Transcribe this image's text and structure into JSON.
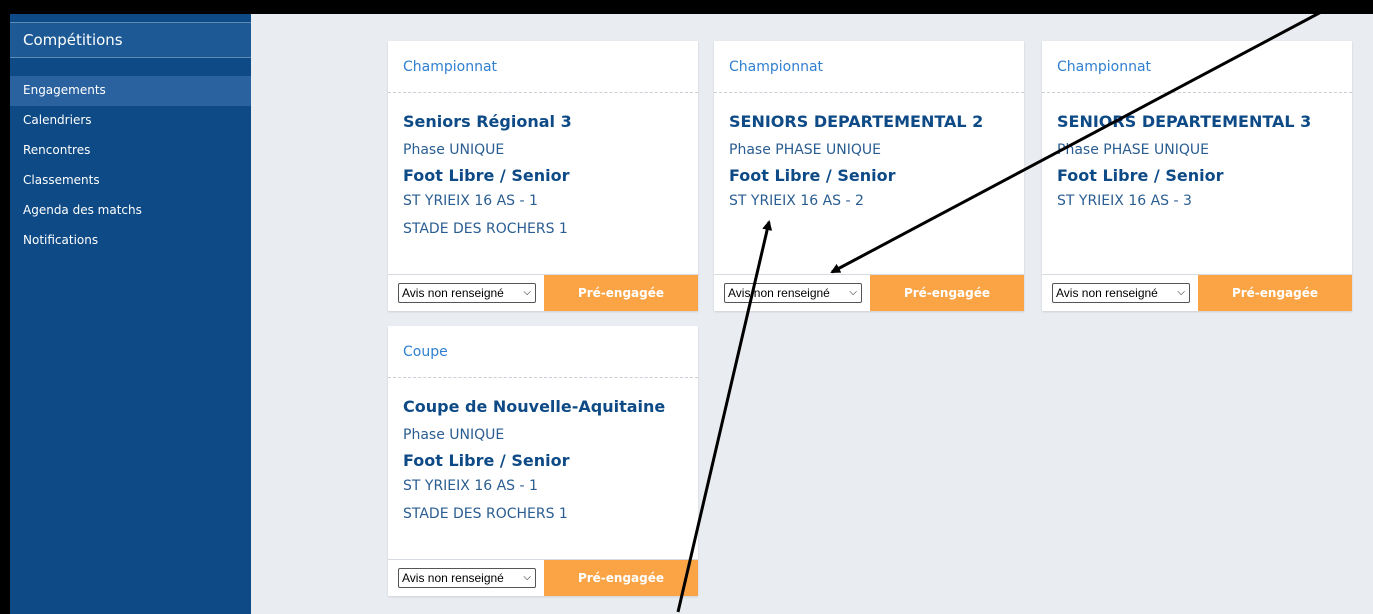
{
  "sidebar": {
    "title": "Compétitions",
    "items": [
      {
        "label": "Engagements",
        "active": true
      },
      {
        "label": "Calendriers"
      },
      {
        "label": "Rencontres"
      },
      {
        "label": "Classements"
      },
      {
        "label": "Agenda des matchs"
      },
      {
        "label": "Notifications"
      }
    ]
  },
  "cards": [
    {
      "type": "Championnat",
      "competition": "Seniors Régional 3",
      "phase": "Phase UNIQUE",
      "category": "Foot Libre / Senior",
      "team": "ST YRIEIX 16 AS - 1",
      "stadium": "STADE DES ROCHERS 1",
      "avis": "Avis non renseigné",
      "status": "Pré-engagée"
    },
    {
      "type": "Championnat",
      "competition": "SENIORS DEPARTEMENTAL 2",
      "phase": "Phase PHASE UNIQUE",
      "category": "Foot Libre / Senior",
      "team": "ST YRIEIX 16 AS - 2",
      "stadium": "",
      "avis": "Avis non renseigné",
      "status": "Pré-engagée"
    },
    {
      "type": "Championnat",
      "competition": "SENIORS DEPARTEMENTAL 3",
      "phase": "Phase PHASE UNIQUE",
      "category": "Foot Libre / Senior",
      "team": "ST YRIEIX 16 AS - 3",
      "stadium": "",
      "avis": "Avis non renseigné",
      "status": "Pré-engagée"
    },
    {
      "type": "Coupe",
      "competition": "Coupe de Nouvelle-Aquitaine",
      "phase": "Phase UNIQUE",
      "category": "Foot Libre / Senior",
      "team": "ST YRIEIX 16 AS - 1",
      "stadium": "STADE DES ROCHERS 1",
      "avis": "Avis non renseigné",
      "status": "Pré-engagée"
    }
  ],
  "colors": {
    "sidebar_bg": "#0d4a86",
    "accent_orange": "#fba446",
    "link_blue": "#2f7fd0",
    "page_bg": "#e9ecf1"
  }
}
